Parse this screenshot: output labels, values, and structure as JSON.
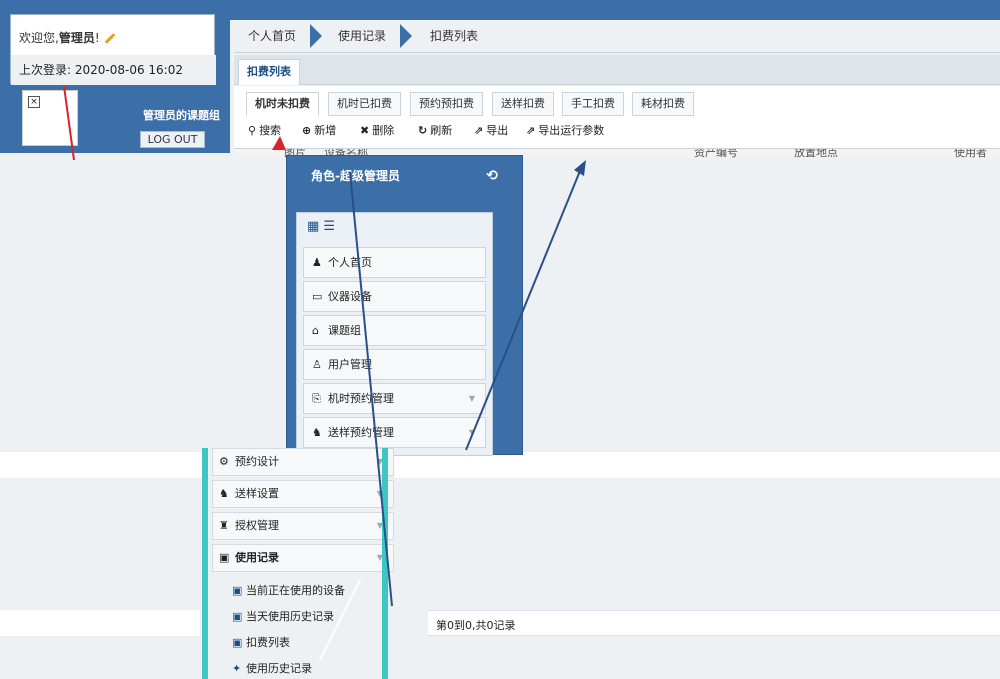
{
  "user": {
    "welcome_prefix": "欢迎您,",
    "username": "管理员",
    "welcome_suffix": "!",
    "last_login": "上次登录:  2020-08-06 16:02",
    "group_name": "管理员的课题组",
    "logout_label": "LOG OUT"
  },
  "breadcrumb": [
    "个人首页",
    "使用记录",
    "扣费列表"
  ],
  "page_tab": "扣费列表",
  "subtabs": [
    "机时未扣费",
    "机时已扣费",
    "预约预扣费",
    "送样扣费",
    "手工扣费",
    "耗材扣费"
  ],
  "toolbar": {
    "search": "搜索",
    "add": "新增",
    "delete": "删除",
    "refresh": "刷新",
    "export": "导出",
    "export_params": "导出运行参数"
  },
  "table_headers": [
    "图片",
    "设备名称",
    "资产编号",
    "放置地点",
    "使用者"
  ],
  "menu": {
    "role": "角色-超级管理员",
    "items": [
      "个人首页",
      "仪器设备",
      "课题组",
      "用户管理",
      "机时预约管理",
      "送样预约管理"
    ]
  },
  "lower_menu": {
    "items": [
      "预约设计",
      "送样设置",
      "授权管理",
      "使用记录"
    ],
    "subitems": [
      "当前正在使用的设备",
      "当天使用历史记录",
      "扣费列表",
      "使用历史记录"
    ]
  },
  "pagination": "第0到0,共0记录",
  "colors": {
    "primary": "#3c6ea8",
    "teal": "#3ec7c2",
    "annotation": "#d9232b"
  }
}
